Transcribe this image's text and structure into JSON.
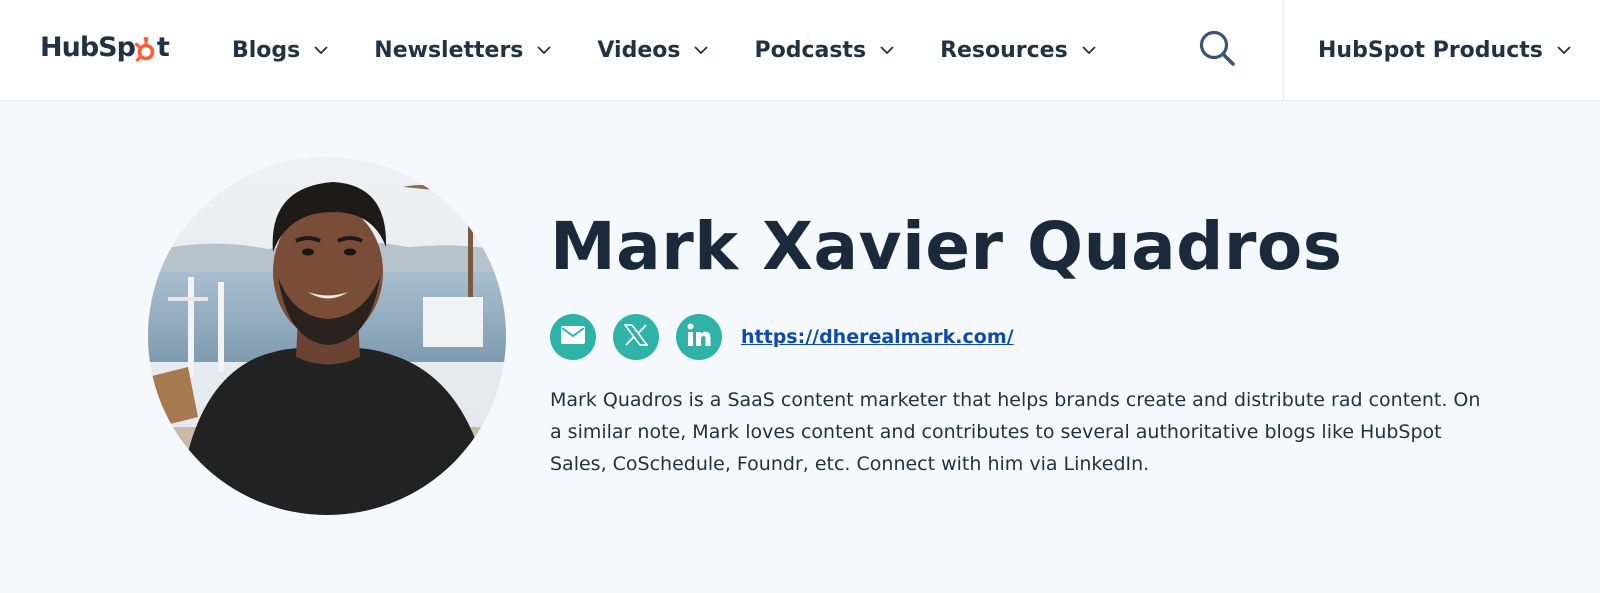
{
  "header": {
    "logo": {
      "text_before": "HubSp",
      "text_after": "t",
      "alt": "HubSpot",
      "accent_color": "#ff5c35"
    },
    "nav": [
      {
        "label": "Blogs",
        "icon": "chevron-down-icon"
      },
      {
        "label": "Newsletters",
        "icon": "chevron-down-icon"
      },
      {
        "label": "Videos",
        "icon": "chevron-down-icon"
      },
      {
        "label": "Podcasts",
        "icon": "chevron-down-icon"
      },
      {
        "label": "Resources",
        "icon": "chevron-down-icon"
      }
    ],
    "search_icon": "search-icon",
    "products_label": "HubSpot Products"
  },
  "author": {
    "name": "Mark Xavier Quadros",
    "photo_alt": "Mark Xavier Quadros",
    "social": [
      {
        "name": "email",
        "icon": "email-icon"
      },
      {
        "name": "x",
        "icon": "x-twitter-icon"
      },
      {
        "name": "linkedin",
        "icon": "linkedin-icon"
      }
    ],
    "website": "https://dherealmark.com/",
    "bio": "Mark Quadros is a SaaS content marketer that helps brands create and distribute rad content. On a similar note, Mark loves content and contributes to several authoritative blogs like HubSpot Sales, CoSchedule, Foundr, etc. Connect with him via LinkedIn."
  },
  "colors": {
    "page_background": "#f5f8fc",
    "header_background": "#ffffff",
    "text_dark": "#213343",
    "social_teal": "#2fb3a9",
    "link_blue": "#0f4bad",
    "brand_orange": "#ff5c35"
  }
}
